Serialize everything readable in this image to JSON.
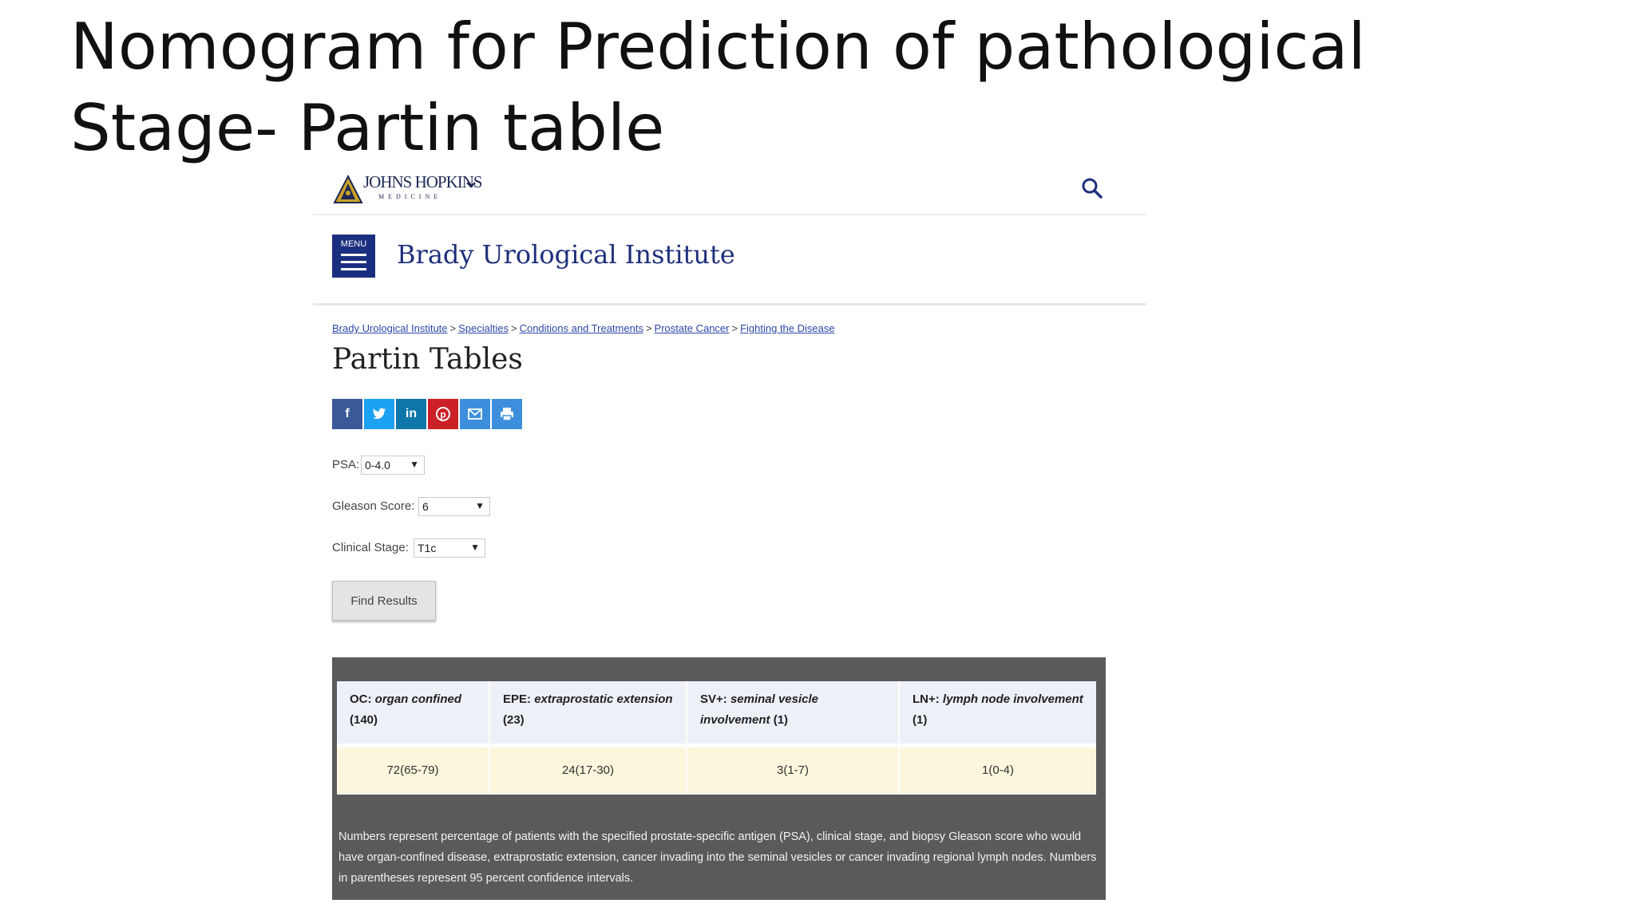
{
  "slide": {
    "title": "Nomogram for Prediction of pathological Stage- Partin table"
  },
  "header": {
    "logo_text": "JOHNS HOPKINS",
    "logo_subtext": "MEDICINE",
    "logo_icon": "shield-logo-icon",
    "menu_icon": "chevron-down-icon",
    "search_icon": "search-icon"
  },
  "site": {
    "menu_label": "MENU",
    "name": "Brady Urological Institute"
  },
  "breadcrumb": [
    "Brady Urological Institute",
    "Specialties",
    "Conditions and Treatments",
    "Prostate Cancer",
    "Fighting the Disease"
  ],
  "page_title": "Partin Tables",
  "share_buttons": [
    {
      "icon": "facebook-icon",
      "glyph": "f",
      "color": "#3b5998"
    },
    {
      "icon": "twitter-icon",
      "glyph": "🐦",
      "color": "#1da1f2"
    },
    {
      "icon": "linkedin-icon",
      "glyph": "in",
      "color": "#0e76a8"
    },
    {
      "icon": "pinterest-icon",
      "glyph": "P",
      "color": "#cb2027"
    },
    {
      "icon": "email-icon",
      "glyph": "✉",
      "color": "#3d8fdd"
    },
    {
      "icon": "print-icon",
      "glyph": "⎙",
      "color": "#3d8fdd"
    }
  ],
  "form": {
    "psa": {
      "label": "PSA:",
      "value": "0-4.0"
    },
    "gleason": {
      "label": "Gleason Score:",
      "value": "6"
    },
    "stage": {
      "label": "Clinical Stage:",
      "value": "T1c"
    },
    "submit_label": "Find Results"
  },
  "results": {
    "columns": [
      {
        "abbr": "OC:",
        "desc": "organ confined",
        "count": "(140)"
      },
      {
        "abbr": "EPE:",
        "desc": "extraprostatic extension",
        "count": "(23)"
      },
      {
        "abbr": "SV+:",
        "desc": "seminal vesicle involvement",
        "count": "(1)"
      },
      {
        "abbr": "LN+:",
        "desc": "lymph node involvement",
        "count": "(1)"
      }
    ],
    "values": [
      "72(65-79)",
      "24(17-30)",
      "3(1-7)",
      "1(0-4)"
    ],
    "note": "Numbers represent percentage of patients with the specified prostate-specific antigen (PSA), clinical stage, and biopsy Gleason score who would have organ-confined disease, extraprostatic extension, cancer invading into the seminal vesicles or cancer invading regional lymph nodes. Numbers in parentheses represent 95 percent confidence intervals."
  },
  "colors": {
    "brand_navy": "#1b2f80",
    "link": "#2d47a8",
    "results_bg": "#5a5a5a",
    "header_cell": "#eef0f8",
    "value_cell": "#fbf6dc"
  }
}
